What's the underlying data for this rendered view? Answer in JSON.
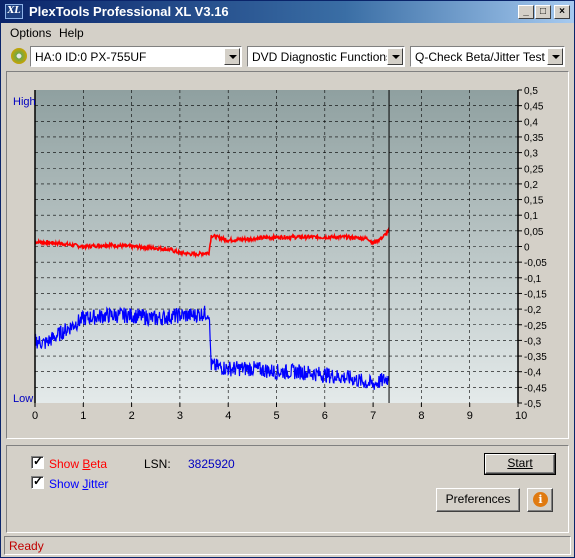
{
  "window": {
    "title": "PlexTools Professional XL V3.16",
    "icon_text": "XL"
  },
  "menu": {
    "options": "Options",
    "help": "Help"
  },
  "toolbar": {
    "drive": "HA:0 ID:0  PX-755UF",
    "function": "DVD Diagnostic Functions",
    "test": "Q-Check Beta/Jitter Test"
  },
  "chart_data": {
    "type": "line",
    "left_axis": {
      "high_label": "High",
      "low_label": "Low"
    },
    "x_ticks": [
      "0",
      "1",
      "2",
      "3",
      "4",
      "5",
      "6",
      "7",
      "8",
      "9",
      "10"
    ],
    "xlim": [
      0,
      10
    ],
    "y_ticks": [
      "0,5",
      "0,45",
      "0,4",
      "0,35",
      "0,3",
      "0,25",
      "0,2",
      "0,15",
      "0,1",
      "0,05",
      "0",
      "-0,05",
      "-0,1",
      "-0,15",
      "-0,2",
      "-0,25",
      "-0,3",
      "-0,35",
      "-0,4",
      "-0,45",
      "-0,5"
    ],
    "ylim": [
      -0.5,
      0.5
    ],
    "end_marker_x": 7.33,
    "series": [
      {
        "name": "Beta",
        "color": "#ff0000",
        "x": [
          0,
          0.5,
          1,
          1.5,
          2,
          2.5,
          2.8,
          3,
          3.3,
          3.6,
          3.65,
          4,
          4.5,
          5,
          5.5,
          6,
          6.5,
          6.9,
          7,
          7.2,
          7.33
        ],
        "y": [
          0.015,
          0.01,
          0.0,
          0.005,
          0.0,
          -0.005,
          -0.01,
          -0.02,
          -0.025,
          -0.02,
          0.035,
          0.02,
          0.025,
          0.03,
          0.03,
          0.03,
          0.03,
          0.025,
          0.01,
          0.03,
          0.05
        ]
      },
      {
        "name": "Jitter",
        "color": "#0000ff",
        "x": [
          0,
          0.2,
          0.4,
          0.6,
          0.8,
          1,
          1.5,
          2,
          2.5,
          3,
          3.3,
          3.6,
          3.65,
          4,
          4.5,
          5,
          5.5,
          6,
          6.5,
          7,
          7.33
        ],
        "y": [
          -0.3,
          -0.31,
          -0.29,
          -0.27,
          -0.25,
          -0.23,
          -0.22,
          -0.22,
          -0.23,
          -0.22,
          -0.22,
          -0.21,
          -0.38,
          -0.39,
          -0.39,
          -0.4,
          -0.4,
          -0.41,
          -0.42,
          -0.44,
          -0.42
        ]
      }
    ]
  },
  "controls": {
    "show_beta_prefix": "Show ",
    "show_beta_key": "B",
    "show_beta_suffix": "eta",
    "show_jitter_prefix": "Show ",
    "show_jitter_key": "J",
    "show_jitter_suffix": "itter",
    "lsn_label": "LSN:",
    "lsn_value": "3825920",
    "start_label": "Start",
    "preferences_label": "Preferences",
    "info_icon": "i"
  },
  "status": {
    "text": "Ready"
  },
  "colors": {
    "beta": "#ff0000",
    "jitter": "#0000ff",
    "axis_label": "#0000c0"
  }
}
